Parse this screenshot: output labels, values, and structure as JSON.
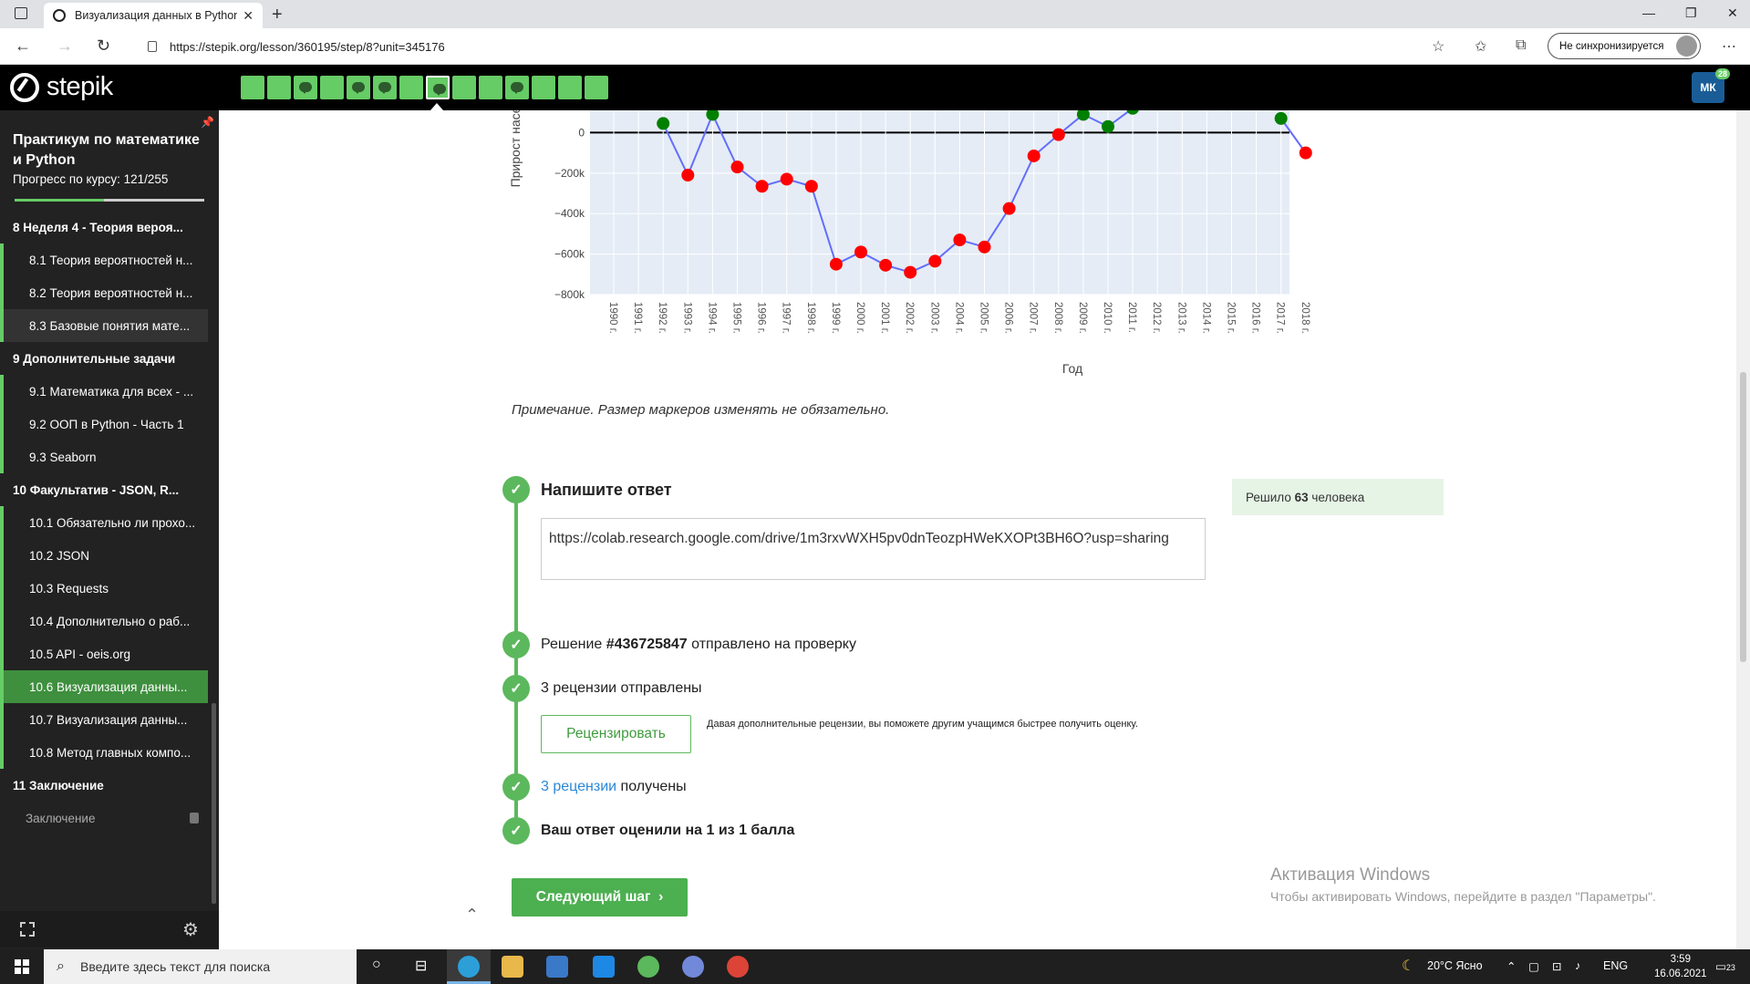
{
  "browser": {
    "tab_title": "Визуализация данных в Python",
    "url": "https://stepik.org/lesson/360195/step/8?unit=345176",
    "sync_label": "Не синхронизируется"
  },
  "header": {
    "logo": "stepik",
    "user_initials": "МК",
    "notifications": "28",
    "steps": [
      {
        "type": "plain"
      },
      {
        "type": "plain"
      },
      {
        "type": "comment"
      },
      {
        "type": "plain"
      },
      {
        "type": "comment"
      },
      {
        "type": "comment"
      },
      {
        "type": "plain"
      },
      {
        "type": "comment",
        "current": true
      },
      {
        "type": "plain"
      },
      {
        "type": "plain"
      },
      {
        "type": "comment"
      },
      {
        "type": "plain"
      },
      {
        "type": "plain"
      },
      {
        "type": "plain"
      }
    ]
  },
  "sidebar": {
    "course_title": "Практикум по математике и Python",
    "progress_text": "Прогресс по курсу:  121/255",
    "progress_fraction": 0.47,
    "items": [
      {
        "kind": "mod",
        "label": "8  Неделя 4 - Теория вероя..."
      },
      {
        "kind": "less",
        "label": "8.1  Теория вероятностей н..."
      },
      {
        "kind": "less",
        "label": "8.2  Теория вероятностей н..."
      },
      {
        "kind": "less",
        "label": "8.3  Базовые понятия мате...",
        "state": "light"
      },
      {
        "kind": "mod",
        "label": "9  Дополнительные задачи"
      },
      {
        "kind": "less",
        "label": "9.1  Математика для всех - ..."
      },
      {
        "kind": "less",
        "label": "9.2  ООП в Python - Часть 1"
      },
      {
        "kind": "less",
        "label": "9.3  Seaborn"
      },
      {
        "kind": "mod",
        "label": "10  Факультатив - JSON, R..."
      },
      {
        "kind": "less",
        "label": "10.1  Обязательно ли прохо..."
      },
      {
        "kind": "less",
        "label": "10.2  JSON"
      },
      {
        "kind": "less",
        "label": "10.3  Requests"
      },
      {
        "kind": "less",
        "label": "10.4  Дополнительно о раб..."
      },
      {
        "kind": "less",
        "label": "10.5  API - oeis.org"
      },
      {
        "kind": "less",
        "label": "10.6  Визуализация данны...",
        "state": "sel"
      },
      {
        "kind": "less",
        "label": "10.7  Визуализация данны..."
      },
      {
        "kind": "less",
        "label": "10.8  Метод главных компо..."
      },
      {
        "kind": "mod",
        "label": "11  Заключение"
      },
      {
        "kind": "lock",
        "label": "Заключение"
      }
    ]
  },
  "chart_data": {
    "type": "line",
    "xlabel": "Год",
    "ylabel": "Прирост насе",
    "yticks": [
      "0",
      "−200k",
      "−400k",
      "−600k",
      "−800k"
    ],
    "ylim": [
      -800000,
      110000
    ],
    "categories": [
      "1990 г.",
      "1991 г.",
      "1992 г.",
      "1993 г.",
      "1994 г.",
      "1995 г.",
      "1996 г.",
      "1997 г.",
      "1998 г.",
      "1999 г.",
      "2000 г.",
      "2001 г.",
      "2002 г.",
      "2003 г.",
      "2004 г.",
      "2005 г.",
      "2006 г.",
      "2007 г.",
      "2008 г.",
      "2009 г.",
      "2010 г.",
      "2011 г.",
      "2012 г.",
      "2013 г.",
      "2014 г.",
      "2015 г.",
      "2016 г.",
      "2017 г.",
      "2018 г."
    ],
    "values": [
      null,
      null,
      45000,
      -210000,
      90000,
      -170000,
      -265000,
      -230000,
      -265000,
      -650000,
      -590000,
      -655000,
      -690000,
      -635000,
      -530000,
      -565000,
      -375000,
      -115000,
      -10000,
      90000,
      30000,
      120000,
      null,
      null,
      null,
      null,
      null,
      70000,
      -100000
    ],
    "positive_color": "#008000",
    "negative_color": "#ff0000",
    "line_color": "#636efa"
  },
  "main": {
    "note": "Примечание. Размер маркеров изменять не обязательно.",
    "answer_title": "Напишите ответ",
    "answer_text": "https://colab.research.google.com/drive/1m3rxvWXH5pv0dnTeozpHWeKXOPt3BH6O?usp=sharing",
    "solved_prefix": "Решило ",
    "solved_count": "63",
    "solved_suffix": " человека",
    "submission_prefix": "Решение ",
    "submission_id": "#436725847",
    "submission_suffix": " отправлено на проверку",
    "reviews_sent": "3 рецензии отправлены",
    "review_button": "Рецензировать",
    "review_hint": "Давая дополнительные рецензии, вы поможете другим учащимся быстрее получить оценку.",
    "reviews_received_link": "3 рецензии",
    "reviews_received_suffix": " получены",
    "score_text": "Ваш ответ оценили на 1 из 1 балла",
    "next_button": "Следующий шаг"
  },
  "watermark": {
    "title": "Активация Windows",
    "subtitle": "Чтобы активировать Windows, перейдите в раздел \"Параметры\"."
  },
  "taskbar": {
    "search_placeholder": "Введите здесь текст для поиска",
    "weather": "20°C  Ясно",
    "lang": "ENG",
    "time": "3:59",
    "date": "16.06.2021",
    "notif_count": "23"
  }
}
